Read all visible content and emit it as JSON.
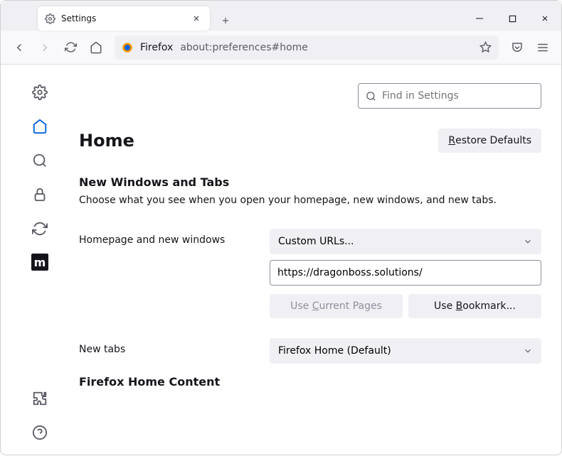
{
  "window": {
    "tab_title": "Settings"
  },
  "toolbar": {
    "url_prefix": "Firefox",
    "url_text": "about:preferences#home"
  },
  "search": {
    "placeholder": "Find in Settings"
  },
  "page": {
    "title": "Home",
    "restore_btn": "Restore Defaults",
    "section1_title": "New Windows and Tabs",
    "section1_desc": "Choose what you see when you open your homepage, new windows, and new tabs.",
    "homepage_label": "Homepage and new windows",
    "homepage_select": "Custom URLs...",
    "homepage_value": "https://dragonboss.solutions/",
    "use_current": "Use Current Pages",
    "use_bookmark": "Use Bookmark...",
    "newtabs_label": "New tabs",
    "newtabs_select": "Firefox Home (Default)",
    "section2_title": "Firefox Home Content"
  },
  "sidebar": {
    "m_label": "m"
  }
}
